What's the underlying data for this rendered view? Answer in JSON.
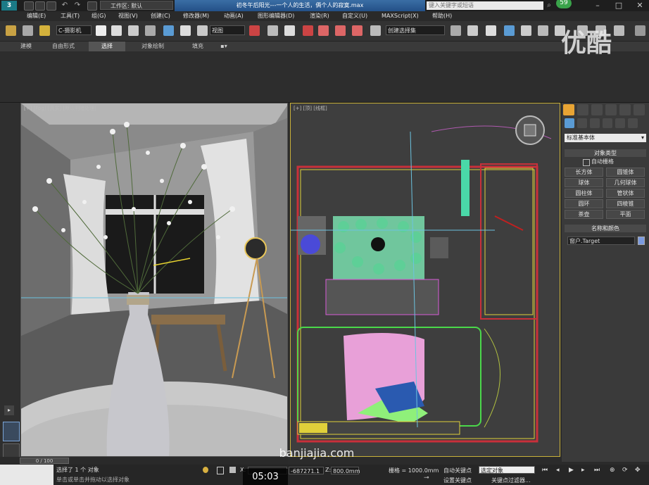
{
  "titlebar": {
    "workspace": "工作区: 默认",
    "doc_title": "初冬午后阳光---一个人的生活，俩个人的寂寞.max",
    "search_placeholder": "键入关键字或短语",
    "badge_count": "59"
  },
  "menu": [
    "编辑(E)",
    "工具(T)",
    "组(G)",
    "视图(V)",
    "创建(C)",
    "修改器(M)",
    "动画(A)",
    "图形编辑器(D)",
    "渲染(R)",
    "自定义(U)",
    "MAXScript(X)",
    "帮助(H)"
  ],
  "toolbar": {
    "selection_filter": "C-摄影机",
    "ref_coord": "视图",
    "named_selection": "创建选择集"
  },
  "ribbon_tabs": [
    "建模",
    "自由形式",
    "选择",
    "对象绘制",
    "填充"
  ],
  "viewports": {
    "camera_label": "[+] [Fog] [真实] [默认明暗处理]",
    "top_label": "[+] [顶] [线框]"
  },
  "command_panel": {
    "category": "标准基本体",
    "object_type_title": "对象类型",
    "autogrid": "自动栅格",
    "buttons": [
      "长方体",
      "圆锥体",
      "球体",
      "几何球体",
      "圆柱体",
      "管状体",
      "圆环",
      "四棱锥",
      "茶壶",
      "平面"
    ],
    "name_color_title": "名称和颜色",
    "object_name": "窗户.Target"
  },
  "timeline": {
    "frame": "0 / 100"
  },
  "status": {
    "selected": "选择了 1 个 对象",
    "hint": "单击或单击并拖动以选择对象",
    "x_label": "X:",
    "x_value": "",
    "y_value": "-687271.1",
    "z_label": "Z:",
    "z_value": "800.0mm",
    "grid": "栅格 = 1000.0mm",
    "autokey": "自动关键点",
    "set_key": "设置关键点",
    "key_mode": "选定对象",
    "key_filter": "关键点过滤器..."
  },
  "overlays": {
    "video_time": "05:03",
    "site": "banjiajia.com",
    "logo": "优酷"
  },
  "colors": {
    "active_border": "#c9b13a",
    "title_blue": "#245087",
    "badge_green": "#3aa34a"
  }
}
